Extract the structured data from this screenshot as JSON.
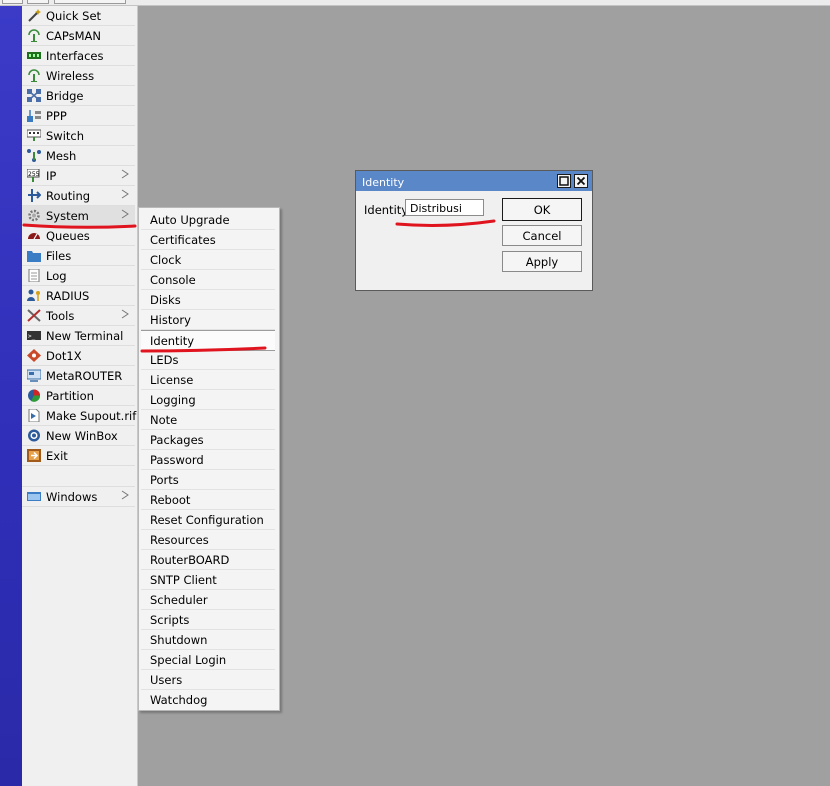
{
  "sidebar": {
    "items": [
      {
        "label": "Quick Set",
        "icon": "wand-icon"
      },
      {
        "label": "CAPsMAN",
        "icon": "antenna-icon"
      },
      {
        "label": "Interfaces",
        "icon": "interfaces-icon"
      },
      {
        "label": "Wireless",
        "icon": "wireless-icon"
      },
      {
        "label": "Bridge",
        "icon": "bridge-icon"
      },
      {
        "label": "PPP",
        "icon": "ppp-icon"
      },
      {
        "label": "Switch",
        "icon": "switch-icon"
      },
      {
        "label": "Mesh",
        "icon": "mesh-icon"
      },
      {
        "label": "IP",
        "icon": "ip-icon"
      },
      {
        "label": "Routing",
        "icon": "routing-icon"
      },
      {
        "label": "System",
        "icon": "gear-icon"
      },
      {
        "label": "Queues",
        "icon": "queues-icon"
      },
      {
        "label": "Files",
        "icon": "folder-icon"
      },
      {
        "label": "Log",
        "icon": "log-icon"
      },
      {
        "label": "RADIUS",
        "icon": "radius-icon"
      },
      {
        "label": "Tools",
        "icon": "tools-icon"
      },
      {
        "label": "New Terminal",
        "icon": "terminal-icon"
      },
      {
        "label": "Dot1X",
        "icon": "dot1x-icon"
      },
      {
        "label": "MetaROUTER",
        "icon": "metarouter-icon"
      },
      {
        "label": "Partition",
        "icon": "partition-icon"
      },
      {
        "label": "Make Supout.rif",
        "icon": "supout-icon"
      },
      {
        "label": "New WinBox",
        "icon": "winbox-icon"
      },
      {
        "label": "Exit",
        "icon": "exit-icon"
      },
      {
        "label": "Windows",
        "icon": "windows-icon"
      }
    ],
    "active": "System"
  },
  "system_menu": {
    "items": [
      "Auto Upgrade",
      "Certificates",
      "Clock",
      "Console",
      "Disks",
      "History",
      "Identity",
      "LEDs",
      "License",
      "Logging",
      "Note",
      "Packages",
      "Password",
      "Ports",
      "Reboot",
      "Reset Configuration",
      "Resources",
      "RouterBOARD",
      "SNTP Client",
      "Scheduler",
      "Scripts",
      "Shutdown",
      "Special Login",
      "Users",
      "Watchdog"
    ],
    "active": "Identity"
  },
  "dialog": {
    "title": "Identity",
    "field_label": "Identity:",
    "field_value": "Distribusi",
    "ok_label": "OK",
    "cancel_label": "Cancel",
    "apply_label": "Apply"
  },
  "colors": {
    "title_bar": "#5a87c7",
    "desktop": "#a0a0a0",
    "left_strip": "#2e2eb8",
    "annotation": "#e0141e"
  }
}
